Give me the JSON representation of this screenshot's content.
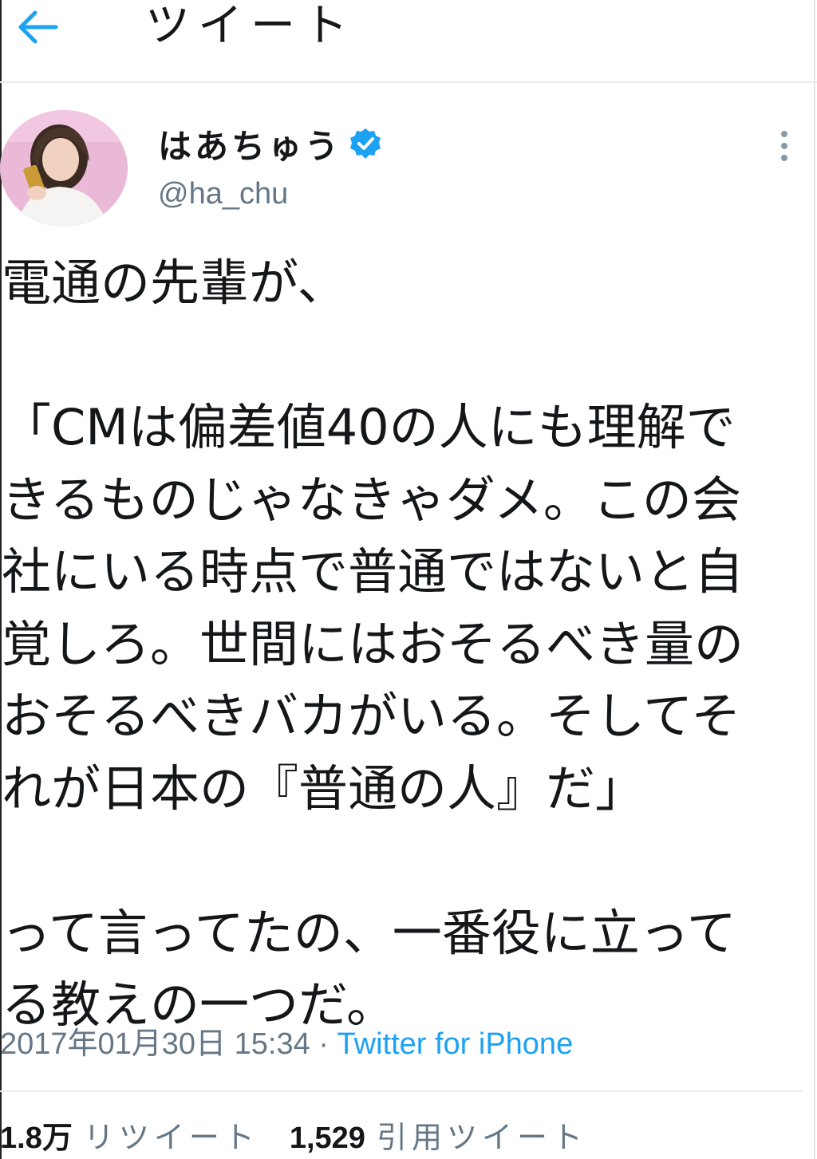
{
  "header": {
    "title": "ツイート",
    "back_icon": "arrow-left-icon"
  },
  "colors": {
    "accent": "#1da1f2",
    "text": "#14171a",
    "secondary": "#657786",
    "verified": "#1da1f2"
  },
  "profile": {
    "display_name": "はあちゅう",
    "handle": "@ha_chu",
    "verified": true,
    "avatar_icon": "avatar",
    "more_icon": "more-vertical-icon"
  },
  "tweet": {
    "lines": [
      "電通の先輩が、",
      "",
      "「CMは偏差値40の人にも理解で",
      "きるものじゃなきゃダメ。この会",
      "社にいる時点で普通ではないと自",
      "覚しろ。世間にはおそるべき量の",
      "おそるべきバカがいる。そしてそ",
      "れが日本の『普通の人』だ」",
      "",
      "って言ってたの、一番役に立って",
      "る教えの一つだ。"
    ]
  },
  "meta": {
    "timestamp": "2017年01月30日 15:34",
    "separator": " · ",
    "source": "Twitter for iPhone"
  },
  "stats": {
    "retweets_count": "1.8万",
    "retweets_label": "リツイート",
    "quotes_count": "1,529",
    "quotes_label": "引用ツイート"
  }
}
